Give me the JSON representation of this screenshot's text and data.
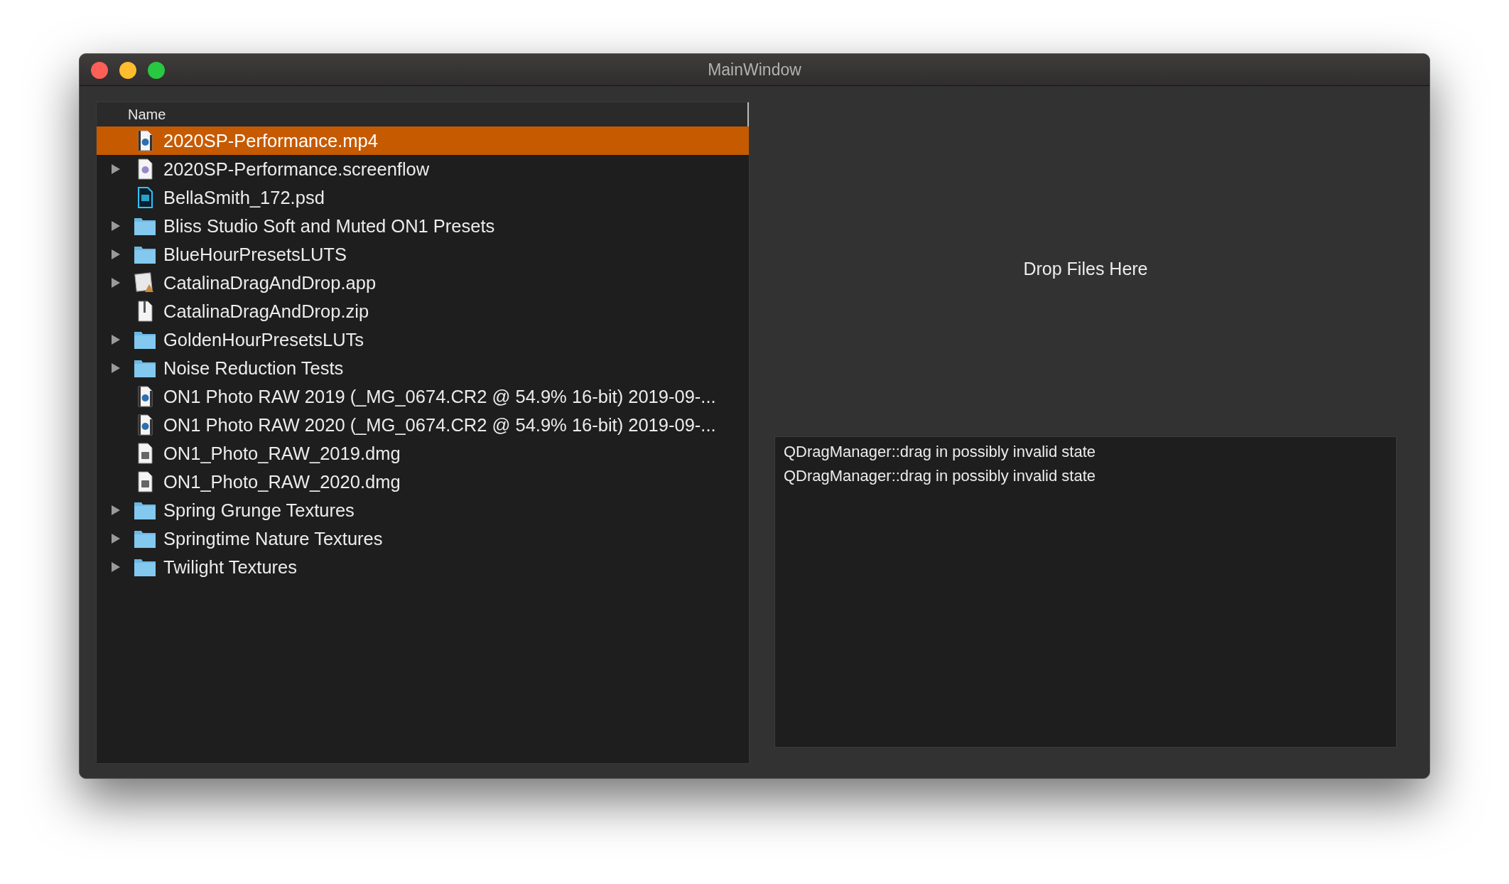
{
  "window": {
    "title": "MainWindow"
  },
  "tree": {
    "column": "Name",
    "items": [
      {
        "name": "2020SP-Performance.mp4",
        "kind": "video",
        "expandable": false,
        "selected": true
      },
      {
        "name": "2020SP-Performance.screenflow",
        "kind": "screenflow",
        "expandable": true,
        "selected": false
      },
      {
        "name": "BellaSmith_172.psd",
        "kind": "psd",
        "expandable": false,
        "selected": false
      },
      {
        "name": "Bliss Studio Soft and Muted ON1 Presets",
        "kind": "folder",
        "expandable": true,
        "selected": false
      },
      {
        "name": "BlueHourPresetsLUTS",
        "kind": "folder",
        "expandable": true,
        "selected": false
      },
      {
        "name": "CatalinaDragAndDrop.app",
        "kind": "app",
        "expandable": true,
        "selected": false
      },
      {
        "name": "CatalinaDragAndDrop.zip",
        "kind": "zip",
        "expandable": false,
        "selected": false
      },
      {
        "name": "GoldenHourPresetsLUTs",
        "kind": "folder",
        "expandable": true,
        "selected": false
      },
      {
        "name": "Noise Reduction Tests",
        "kind": "folder",
        "expandable": true,
        "selected": false
      },
      {
        "name": "ON1 Photo RAW 2019 (_MG_0674.CR2 @ 54.9% 16-bit) 2019-09-...",
        "kind": "video",
        "expandable": false,
        "selected": false
      },
      {
        "name": "ON1 Photo RAW 2020 (_MG_0674.CR2 @ 54.9% 16-bit) 2019-09-...",
        "kind": "video",
        "expandable": false,
        "selected": false
      },
      {
        "name": "ON1_Photo_RAW_2019.dmg",
        "kind": "dmg",
        "expandable": false,
        "selected": false
      },
      {
        "name": "ON1_Photo_RAW_2020.dmg",
        "kind": "dmg",
        "expandable": false,
        "selected": false
      },
      {
        "name": "Spring Grunge Textures",
        "kind": "folder",
        "expandable": true,
        "selected": false
      },
      {
        "name": "Springtime Nature Textures",
        "kind": "folder",
        "expandable": true,
        "selected": false
      },
      {
        "name": "Twilight Textures",
        "kind": "folder",
        "expandable": true,
        "selected": false
      }
    ]
  },
  "drop_area": {
    "label": "Drop Files Here"
  },
  "log": [
    "QDragManager::drag in possibly invalid state",
    "QDragManager::drag in possibly invalid state"
  ]
}
